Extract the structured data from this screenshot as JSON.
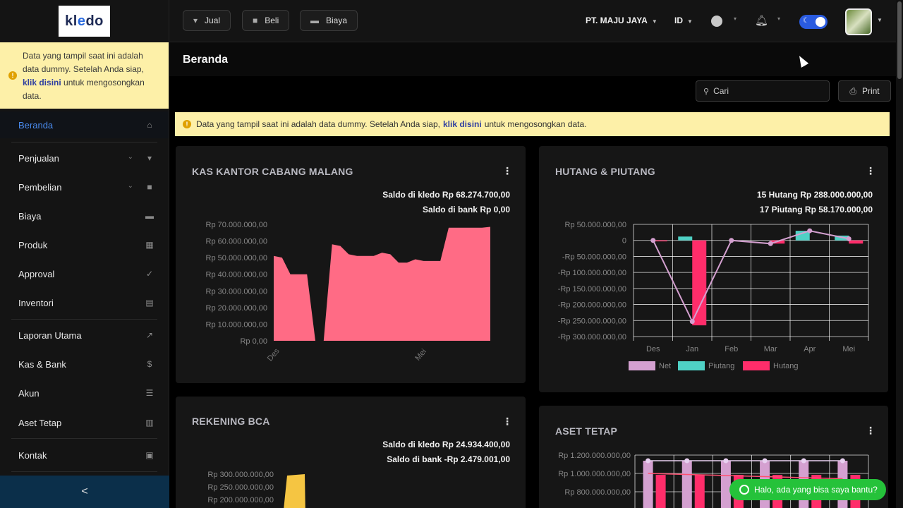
{
  "logo": {
    "text_left": "kl",
    "text_accent": "e",
    "text_right": "do"
  },
  "sidebar": {
    "alert": {
      "text_before": "Data yang tampil saat ini adalah data dummy. Setelah Anda siap, ",
      "link": "klik disini",
      "text_after": " untuk mengosongkan data."
    },
    "items": [
      {
        "label": "Beranda",
        "icon": "home-icon"
      },
      {
        "label": "Penjualan",
        "icon": "basket-icon"
      },
      {
        "label": "Pembelian",
        "icon": "bag-icon"
      },
      {
        "label": "Biaya",
        "icon": "card-icon"
      },
      {
        "label": "Produk",
        "icon": "boxes-icon"
      },
      {
        "label": "Approval",
        "icon": "check-icon"
      },
      {
        "label": "Inventori",
        "icon": "warehouse-icon"
      },
      {
        "label": "Laporan Utama",
        "icon": "chart-icon"
      },
      {
        "label": "Kas & Bank",
        "icon": "dollar-icon"
      },
      {
        "label": "Akun",
        "icon": "list-icon"
      },
      {
        "label": "Aset Tetap",
        "icon": "building-icon"
      },
      {
        "label": "Kontak",
        "icon": "id-card-icon"
      }
    ],
    "collapse": "<"
  },
  "topbar": {
    "buttons": [
      {
        "label": "Jual",
        "icon": "basket-icon"
      },
      {
        "label": "Beli",
        "icon": "bag-icon"
      },
      {
        "label": "Biaya",
        "icon": "card-icon"
      }
    ],
    "company": "PT. MAJU JAYA",
    "lang": "ID"
  },
  "page": {
    "title": "Beranda",
    "search_placeholder": "Cari",
    "print_label": "Print",
    "alert": {
      "text_before": "Data yang tampil saat ini adalah data dummy. Setelah Anda siap,",
      "link": "klik disini",
      "text_after": "untuk mengosongkan data."
    }
  },
  "cards": {
    "kas": {
      "title": "KAS KANTOR CABANG MALANG",
      "line1_label": "Saldo di kledo",
      "line1_value": "Rp 68.274.700,00",
      "line2_label": "Saldo di bank",
      "line2_value": "Rp 0,00"
    },
    "hutang": {
      "title": "HUTANG & PIUTANG",
      "line1_label": "15 Hutang",
      "line1_value": "Rp 288.000.000,00",
      "line2_label": "17 Piutang",
      "line2_value": "Rp 58.170.000,00"
    },
    "bca": {
      "title": "REKENING BCA",
      "line1_label": "Saldo di kledo",
      "line1_value": "Rp 24.934.400,00",
      "line2_label": "Saldo di bank",
      "line2_value": "-Rp 2.479.001,00"
    },
    "aset": {
      "title": "ASET TETAP"
    }
  },
  "chart_data": [
    {
      "type": "area",
      "title": "KAS KANTOR CABANG MALANG",
      "yticks": [
        "Rp 70.000.000,00",
        "Rp 60.000.000,00",
        "Rp 50.000.000,00",
        "Rp 40.000.000,00",
        "Rp 30.000.000,00",
        "Rp 20.000.000,00",
        "Rp 10.000.000,00",
        "Rp 0,00"
      ],
      "xticks": [
        "Des",
        "Mei"
      ],
      "ylim": [
        0,
        70000000
      ],
      "values": [
        51000000,
        50000000,
        40000000,
        40000000,
        40000000,
        0,
        0,
        58000000,
        57000000,
        52000000,
        51000000,
        51000000,
        51000000,
        53000000,
        52000000,
        47000000,
        47000000,
        49000000,
        48000000,
        48000000,
        48000000,
        68000000,
        68000000,
        68000000,
        68000000,
        68000000,
        68500000
      ],
      "color": "#ff6b85"
    },
    {
      "type": "bar",
      "title": "HUTANG & PIUTANG",
      "categories": [
        "Des",
        "Jan",
        "Feb",
        "Mar",
        "Apr",
        "Mei"
      ],
      "yticks": [
        "Rp 50.000.000,00",
        "0",
        "-Rp 50.000.000,00",
        "-Rp 100.000.000,00",
        "-Rp 150.000.000,00",
        "-Rp 200.000.000,00",
        "-Rp 250.000.000,00",
        "-Rp 300.000.000,00"
      ],
      "ylim": [
        -300000000,
        50000000
      ],
      "series": [
        {
          "name": "Net",
          "type": "line",
          "color": "#d4a0d0",
          "values": [
            0,
            -253000000,
            0,
            -10000000,
            30000000,
            5000000
          ]
        },
        {
          "name": "Piutang",
          "type": "bar",
          "color": "#4fd1c5",
          "values": [
            0,
            12000000,
            0,
            0,
            30000000,
            15000000
          ]
        },
        {
          "name": "Hutang",
          "type": "bar",
          "color": "#ff2d6a",
          "values": [
            -3000000,
            -265000000,
            0,
            -10000000,
            0,
            -10000000
          ]
        }
      ]
    },
    {
      "type": "area",
      "title": "REKENING BCA",
      "yticks": [
        "Rp 300.000.000,00",
        "Rp 250.000.000,00",
        "Rp 200.000.000,00"
      ],
      "color": "#f5c542"
    },
    {
      "type": "bar",
      "title": "ASET TETAP",
      "yticks": [
        "Rp 1.200.000.000,00",
        "Rp 1.000.000.000,00",
        "Rp 800.000.000,00"
      ]
    }
  ],
  "chat": {
    "label": "Halo, ada yang bisa saya bantu?"
  }
}
